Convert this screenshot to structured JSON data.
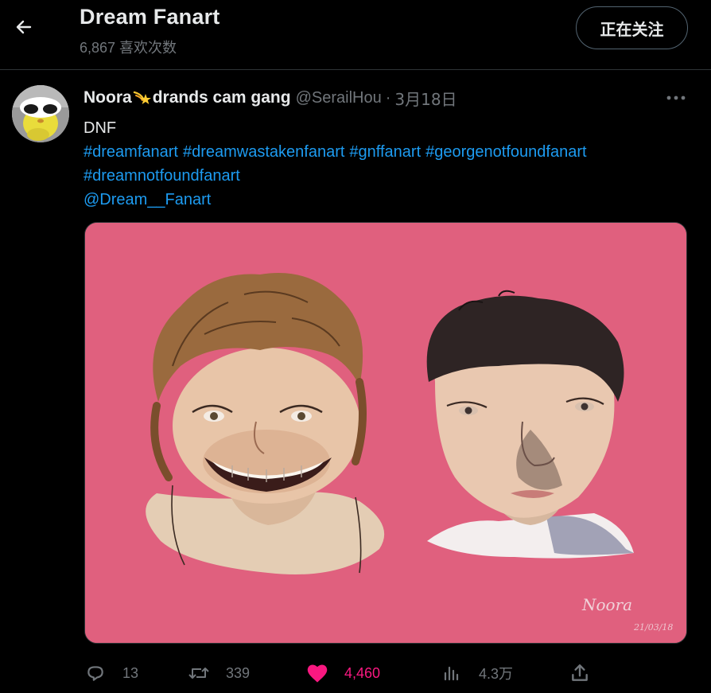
{
  "header": {
    "title": "Dream Fanart",
    "likes_count": "6,867 喜欢次数",
    "follow_label": "正在关注"
  },
  "tweet": {
    "author_name_part1": "Noora",
    "author_name_part2": "drands cam gang",
    "handle": "@SerailHou",
    "separator": "·",
    "date": "3月18日",
    "text": "DNF",
    "hashtags_line1": [
      "#dreamfanart",
      "#dreamwastakenfanart",
      "#gnffanart",
      "#georgenotfoundfanart"
    ],
    "hashtags_line2": [
      "#dreamnotfoundfanart"
    ],
    "mention": "@Dream__Fanart"
  },
  "media": {
    "background_color": "#e0607e",
    "signature": "Noora",
    "signature_date": "21/03/18"
  },
  "actions": {
    "reply_count": "13",
    "retweet_count": "339",
    "like_count": "4,460",
    "views_count": "4.3万"
  },
  "icons": {
    "back": "arrow-left-icon",
    "more": "more-horizontal-icon",
    "reply": "reply-icon",
    "retweet": "retweet-icon",
    "like": "heart-icon",
    "views": "views-icon",
    "share": "share-icon"
  },
  "colors": {
    "link": "#1d9bf0",
    "like": "#f91880",
    "muted": "#71767b",
    "text": "#e7e9ea"
  }
}
